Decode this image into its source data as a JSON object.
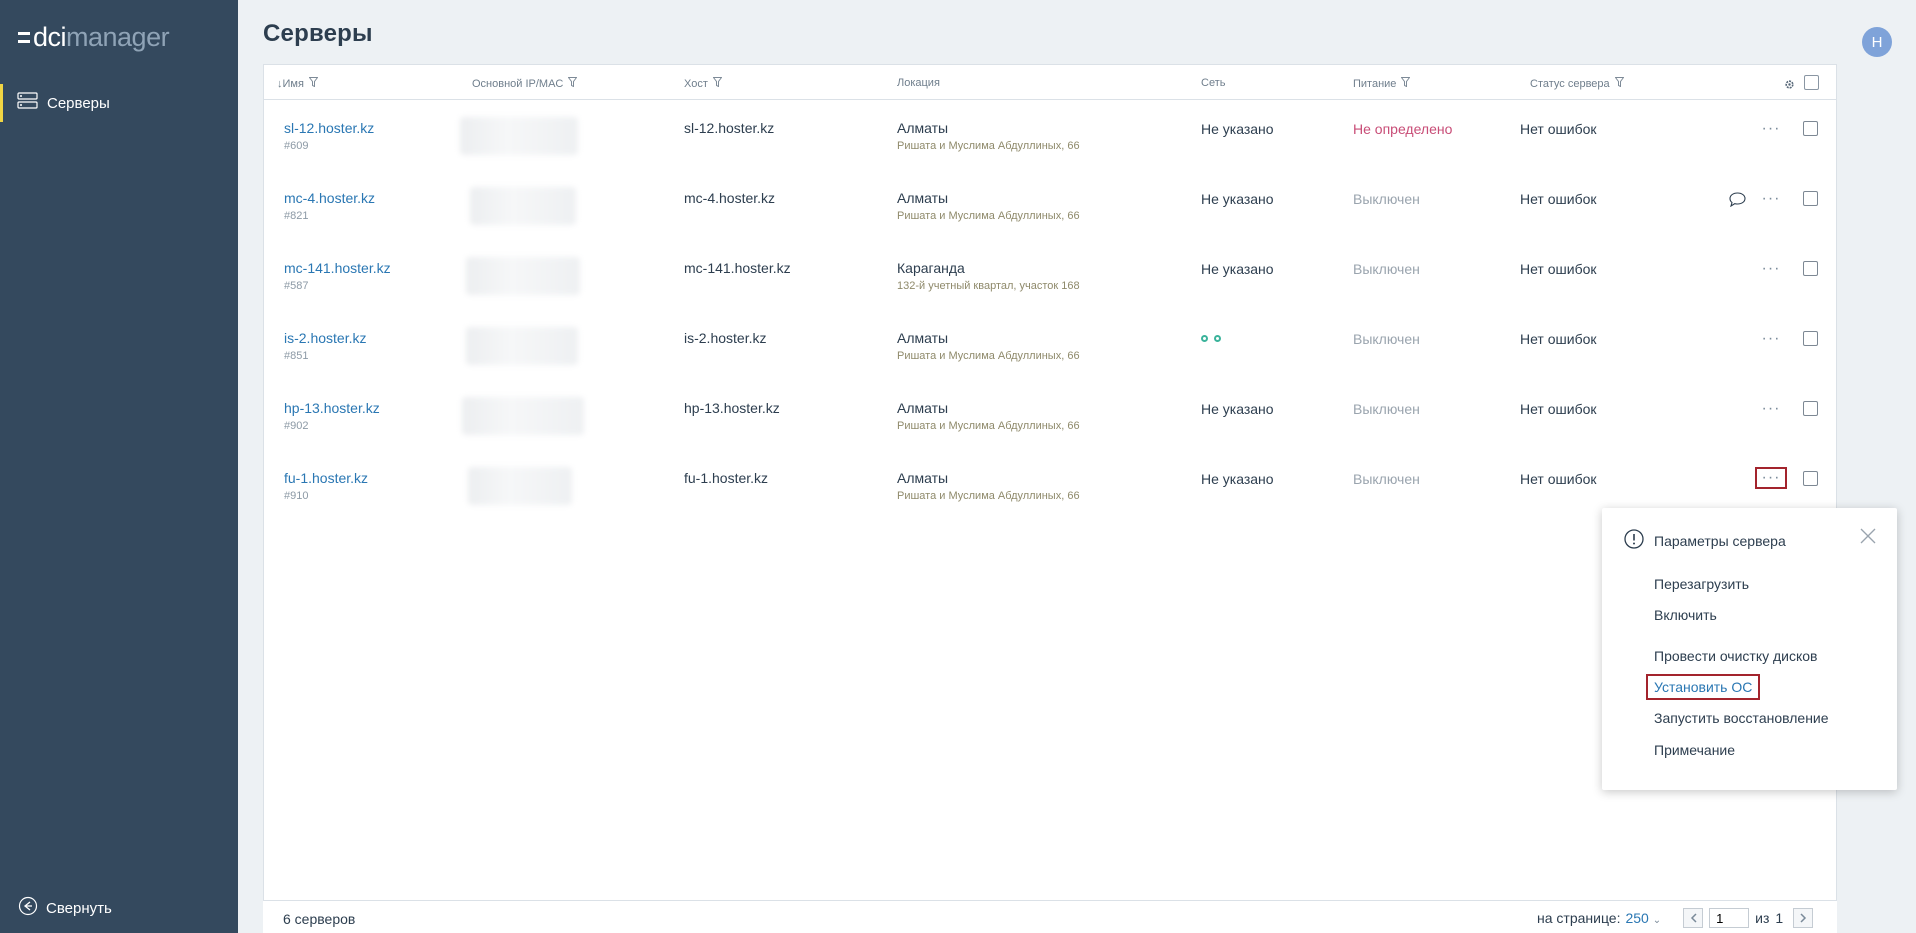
{
  "brand": {
    "dci": "dci",
    "manager": "manager"
  },
  "sidebar": {
    "items": [
      {
        "label": "Серверы",
        "icon": "servers-icon"
      }
    ],
    "collapse_label": "Свернуть",
    "accent_color": "#f0d544"
  },
  "header": {
    "title": "Серверы",
    "avatar_initial": "H"
  },
  "table": {
    "columns": {
      "name": "Имя",
      "sort_arrow": "↓",
      "ip": "Основной IP/MAC",
      "host": "Хост",
      "location": "Локация",
      "network": "Сеть",
      "power": "Питание",
      "status": "Статус сервера"
    },
    "rows": [
      {
        "name": "sl-12.hoster.kz",
        "id": "#609",
        "host": "sl-12.hoster.kz",
        "location": "Алматы",
        "address": "Ришата и Муслима Абдуллиных, 66",
        "network": "Не указано",
        "power": "Не определено",
        "status": "Нет ошибок"
      },
      {
        "name": "mc-4.hoster.kz",
        "id": "#821",
        "host": "mc-4.hoster.kz",
        "location": "Алматы",
        "address": "Ришата и Муслима Абдуллиных, 66",
        "network": "Не указано",
        "power": "Выключен",
        "status": "Нет ошибок"
      },
      {
        "name": "mc-141.hoster.kz",
        "id": "#587",
        "host": "mc-141.hoster.kz",
        "location": "Караганда",
        "address": "132-й учетный квартал, участок 168",
        "network": "Не указано",
        "power": "Выключен",
        "status": "Нет ошибок"
      },
      {
        "name": "is-2.hoster.kz",
        "id": "#851",
        "host": "is-2.hoster.kz",
        "location": "Алматы",
        "address": "Ришата и Муслима Абдуллиных, 66",
        "network": "",
        "power": "Выключен",
        "status": "Нет ошибок"
      },
      {
        "name": "hp-13.hoster.kz",
        "id": "#902",
        "host": "hp-13.hoster.kz",
        "location": "Алматы",
        "address": "Ришата и Муслима Абдуллиных, 66",
        "network": "Не указано",
        "power": "Выключен",
        "status": "Нет ошибок"
      },
      {
        "name": "fu-1.hoster.kz",
        "id": "#910",
        "host": "fu-1.hoster.kz",
        "location": "Алматы",
        "address": "Ришата и Муслима Абдуллиных, 66",
        "network": "Не указано",
        "power": "Выключен",
        "status": "Нет ошибок"
      }
    ],
    "more_label": "···"
  },
  "footer": {
    "count": "6 серверов",
    "per_page_label": "на странице:",
    "per_page_value": "250",
    "page_value": "1",
    "of_label": "из",
    "total_pages": "1"
  },
  "context_menu": {
    "title": "Параметры сервера",
    "items": [
      "Перезагрузить",
      "Включить",
      "Провести очистку дисков",
      "Установить ОС",
      "Запустить восстановление",
      "Примечание"
    ]
  },
  "colors": {
    "sidebar_bg": "#34495e",
    "link": "#2a77b3",
    "power_error": "#c84d77",
    "highlight_border": "#a3242d"
  }
}
